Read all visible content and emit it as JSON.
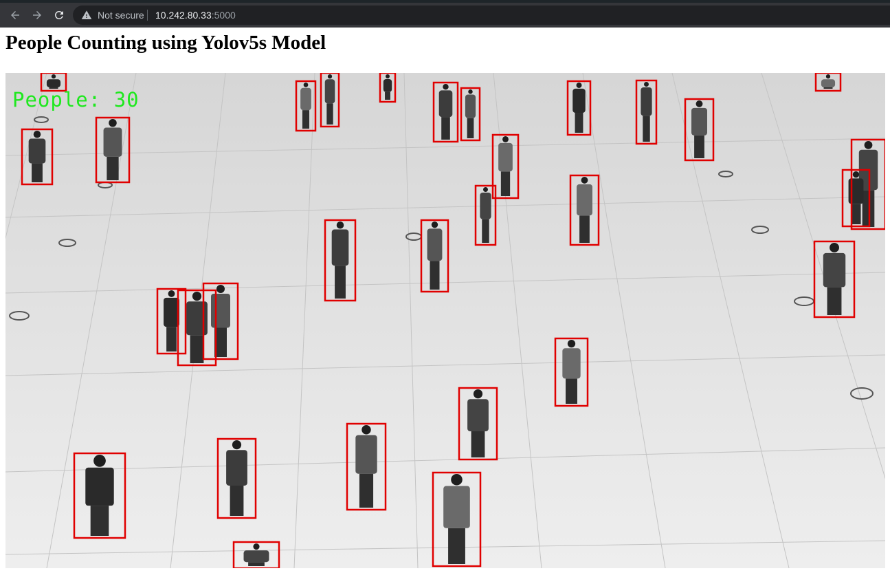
{
  "browser": {
    "security_label": "Not secure",
    "url_host": "10.242.80.33",
    "url_port": ":5000",
    "icons": [
      "back-arrow-icon",
      "forward-arrow-icon",
      "reload-icon",
      "warning-icon"
    ]
  },
  "page": {
    "title": "People Counting using Yolov5s Model"
  },
  "video": {
    "counter_label": "People:",
    "counter_value": "30",
    "box_color": "#e00000",
    "counter_color": "#1ee81e",
    "detections_count": 30
  }
}
